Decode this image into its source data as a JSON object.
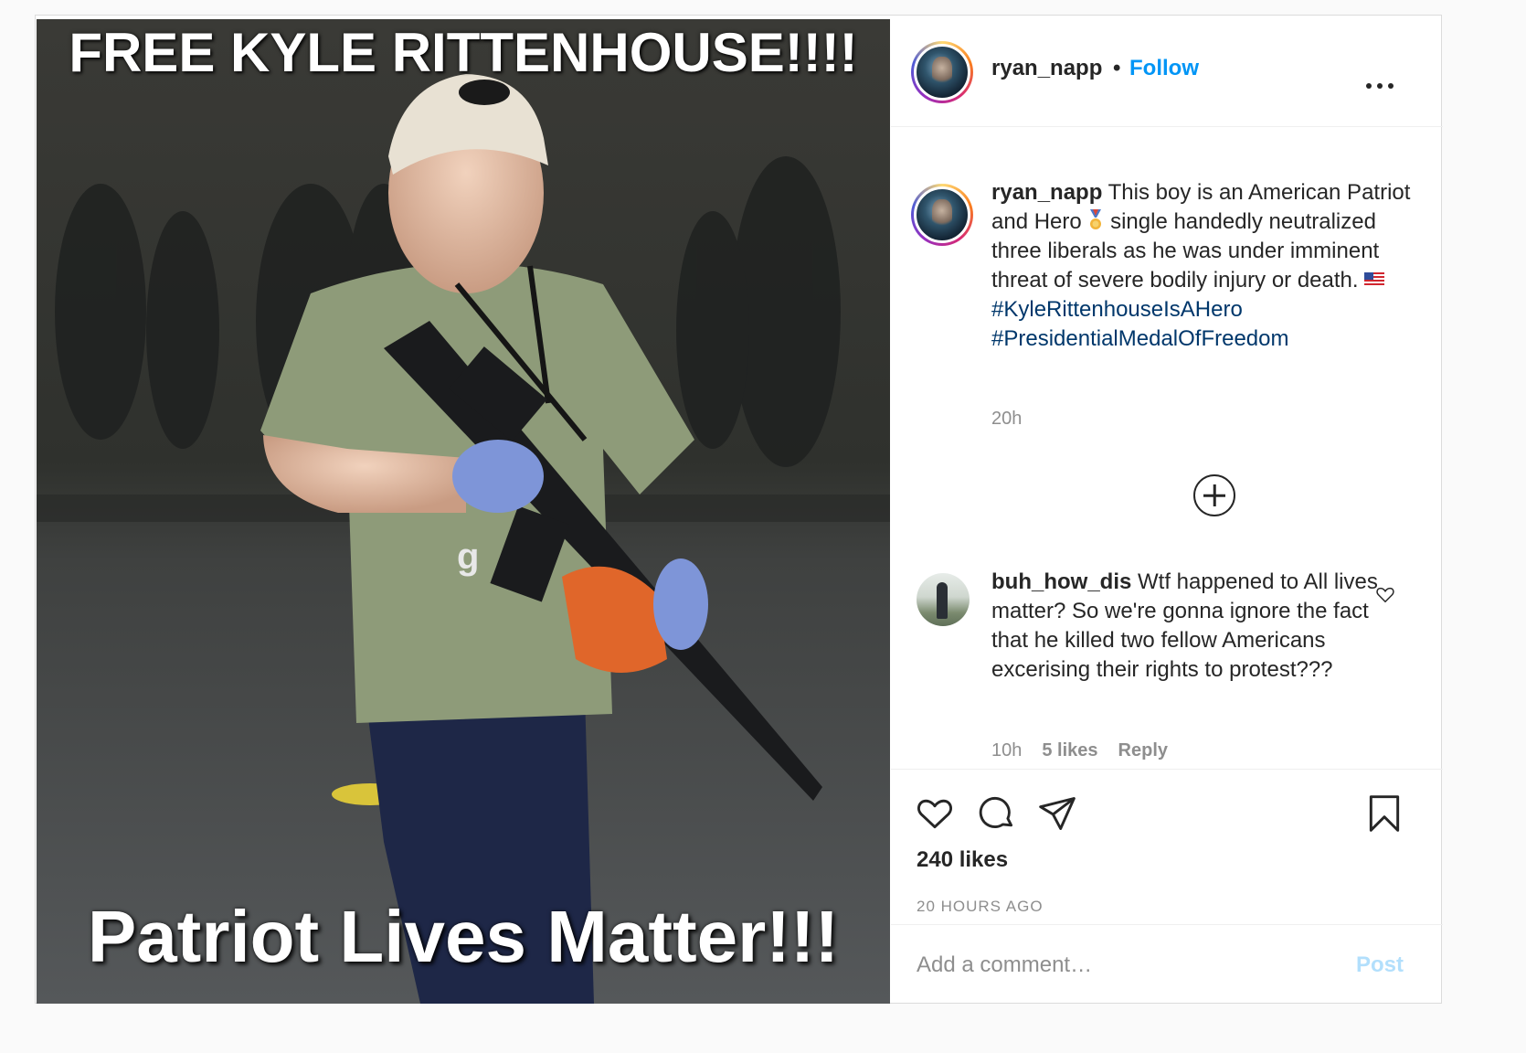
{
  "media": {
    "top_text": "FREE KYLE RITTENHOUSE!!!!",
    "bottom_text": "Patriot Lives Matter!!!",
    "shirt_letter": "g"
  },
  "header": {
    "username": "ryan_napp",
    "separator": "•",
    "follow_label": "Follow"
  },
  "caption": {
    "username": "ryan_napp",
    "text_part1": "This boy is an American Patriot and Hero",
    "text_part2": "single handedly neutralized three liberals as he was under imminent threat of severe bodily injury or death.",
    "hashtags": [
      "#KyleRittenhouseIsAHero",
      "#PresidentialMedalOfFreedom"
    ],
    "time": "20h",
    "emoji_medal": "medal-emoji",
    "emoji_flag": "us-flag-emoji"
  },
  "comment": {
    "username": "buh_how_dis",
    "text": "Wtf happened to All lives matter? So we're gonna ignore the fact that he killed two fellow Americans excerising their rights to protest???",
    "time": "10h",
    "likes": "5 likes",
    "reply_label": "Reply"
  },
  "actions": {
    "likes": "240 likes",
    "time_ago": "20 HOURS AGO"
  },
  "comment_box": {
    "placeholder": "Add a comment…",
    "post_label": "Post"
  },
  "colors": {
    "follow": "#0095f6",
    "hashtag": "#00376b",
    "post_disabled": "#b2dffc",
    "muted": "#8e8e8e"
  }
}
